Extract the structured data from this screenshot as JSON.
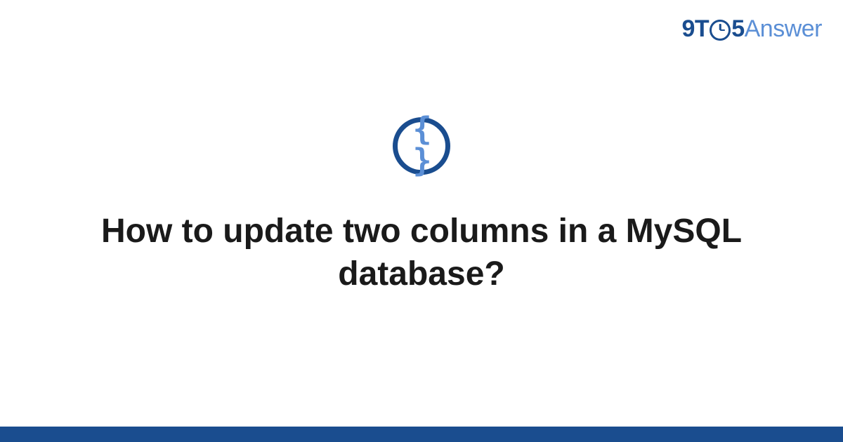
{
  "logo": {
    "part1": "9T",
    "part2": "5",
    "part3": "Answer"
  },
  "icon": {
    "braces": "{ }"
  },
  "title": "How to update two columns in a MySQL database?",
  "colors": {
    "primary": "#1a4d8f",
    "secondary": "#5b8fd6"
  }
}
